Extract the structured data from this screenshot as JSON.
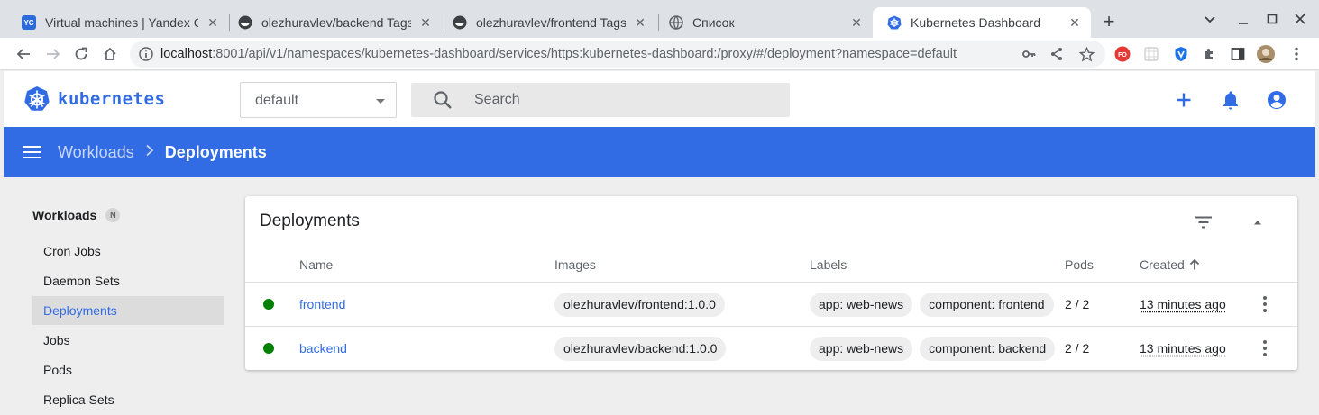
{
  "browser": {
    "tabs": [
      {
        "title": "Virtual machines | Yandex Co",
        "favicon": "yc-icon",
        "favicon_text": "YC",
        "active": false
      },
      {
        "title": "olezhuravlev/backend Tags |",
        "favicon": "docker-hub-icon",
        "active": false
      },
      {
        "title": "olezhuravlev/frontend Tags |",
        "favicon": "docker-hub-icon",
        "active": false
      },
      {
        "title": "Список",
        "favicon": "globe-icon",
        "active": false
      },
      {
        "title": "Kubernetes Dashboard",
        "favicon": "kubernetes-icon",
        "active": true
      }
    ],
    "url_host": "localhost",
    "url_rest": ":8001/api/v1/namespaces/kubernetes-dashboard/services/https:kubernetes-dashboard:/proxy/#/deployment?namespace=default",
    "extension_fo_label": "FO"
  },
  "header": {
    "brand": "kubernetes",
    "namespace": "default",
    "search_placeholder": "Search"
  },
  "breadcrumb": {
    "parent": "Workloads",
    "current": "Deployments"
  },
  "sidebar": {
    "group_label": "Workloads",
    "group_badge": "N",
    "items": [
      {
        "label": "Cron Jobs",
        "active": false
      },
      {
        "label": "Daemon Sets",
        "active": false
      },
      {
        "label": "Deployments",
        "active": true
      },
      {
        "label": "Jobs",
        "active": false
      },
      {
        "label": "Pods",
        "active": false
      },
      {
        "label": "Replica Sets",
        "active": false
      }
    ]
  },
  "card": {
    "title": "Deployments",
    "columns": {
      "name": "Name",
      "images": "Images",
      "labels": "Labels",
      "pods": "Pods",
      "created": "Created",
      "created_sort": "ascending"
    },
    "rows": [
      {
        "status": "running",
        "name": "frontend",
        "image": "olezhuravlev/frontend:1.0.0",
        "labels": [
          "app: web-news",
          "component: frontend"
        ],
        "pods": "2 / 2",
        "created": "13 minutes ago"
      },
      {
        "status": "running",
        "name": "backend",
        "image": "olezhuravlev/backend:1.0.0",
        "labels": [
          "app: web-news",
          "component: backend"
        ],
        "pods": "2 / 2",
        "created": "13 minutes ago"
      }
    ]
  },
  "colors": {
    "brand_blue": "#326ce5",
    "status_green": "#008000"
  }
}
